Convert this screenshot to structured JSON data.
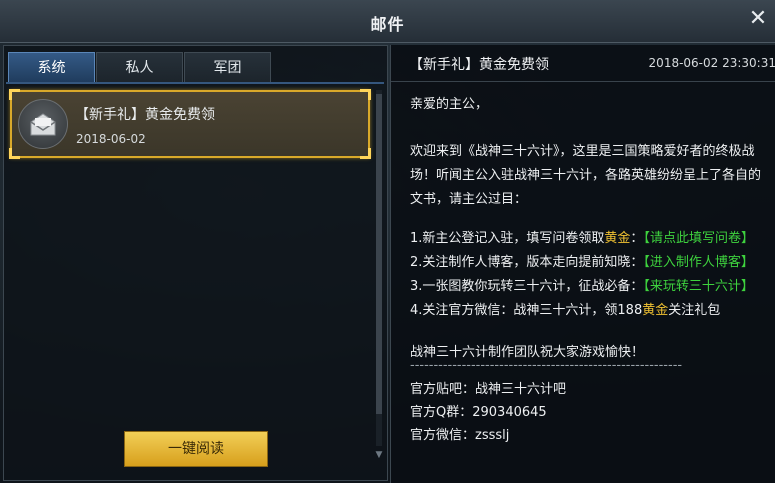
{
  "window": {
    "title": "邮件",
    "close_symbol": "✕"
  },
  "tabs": [
    {
      "label": "系统",
      "active": true
    },
    {
      "label": "私人",
      "active": false
    },
    {
      "label": "军团",
      "active": false
    }
  ],
  "mail_list": [
    {
      "subject": "【新手礼】黄金免费领",
      "date": "2018-06-02",
      "icon": "envelope-icon",
      "selected": true
    }
  ],
  "read_all_label": "一键阅读",
  "detail": {
    "subject": "【新手礼】黄金免费领",
    "time": "2018-06-02 23:30:31",
    "greeting": "亲爱的主公，",
    "intro": [
      "欢迎来到《战神三十六计》，这里是三国策略爱好者的终极战",
      "场！听闻主公入驻战神三十六计，各路英雄纷纷呈上了各自的",
      "文书，请主公过目："
    ],
    "item1": {
      "pre": "1.新主公登记入驻，填写问卷领取",
      "gold": "黄金",
      "mid": "：",
      "link": "【请点此填写问卷】"
    },
    "item2": {
      "pre": "2.关注制作人博客，版本走向提前知晓：",
      "link": "【进入制作人博客】"
    },
    "item3": {
      "pre": "3.一张图教你玩转三十六计，征战必备：",
      "link": "【来玩转三十六计】"
    },
    "item4": {
      "pre": "4.关注官方微信：战神三十六计，领188",
      "gold": "黄金",
      "post": "关注礼包"
    },
    "blessing": "战神三十六计制作团队祝大家游戏愉快！",
    "divider": "----------------------------------------------------------",
    "tieba": "官方贴吧：战神三十六计吧",
    "qq": "官方Q群：290340645",
    "wechat": "官方微信：zssslj"
  },
  "colors": {
    "accent_gold": "#f1c232",
    "link_green": "#3ed23e",
    "tab_active": "#345a86",
    "selection_border": "#d9a92a"
  }
}
